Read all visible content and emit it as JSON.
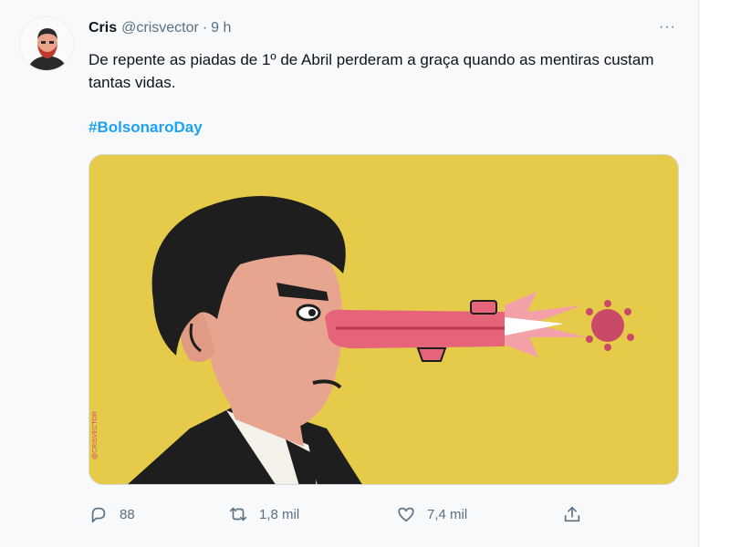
{
  "tweet": {
    "author_name": "Cris",
    "author_handle": "@crisvector",
    "separator": "·",
    "time": "9 h",
    "more": "···",
    "text": "De repente as piadas de 1º de Abril perderam a graça quando as mentiras custam tantas vidas.",
    "hashtag": "#BolsonaroDay",
    "media_signature": "@CRISVECTOR",
    "actions": {
      "replies": "88",
      "retweets": "1,8 mil",
      "likes": "7,4 mil"
    },
    "icons": [
      "reply-icon",
      "retweet-icon",
      "like-icon",
      "share-icon",
      "more-icon"
    ]
  },
  "colors": {
    "accent": "#1da1f2",
    "secondary_text": "#5b7083",
    "media_background": "#e6cb4b"
  }
}
